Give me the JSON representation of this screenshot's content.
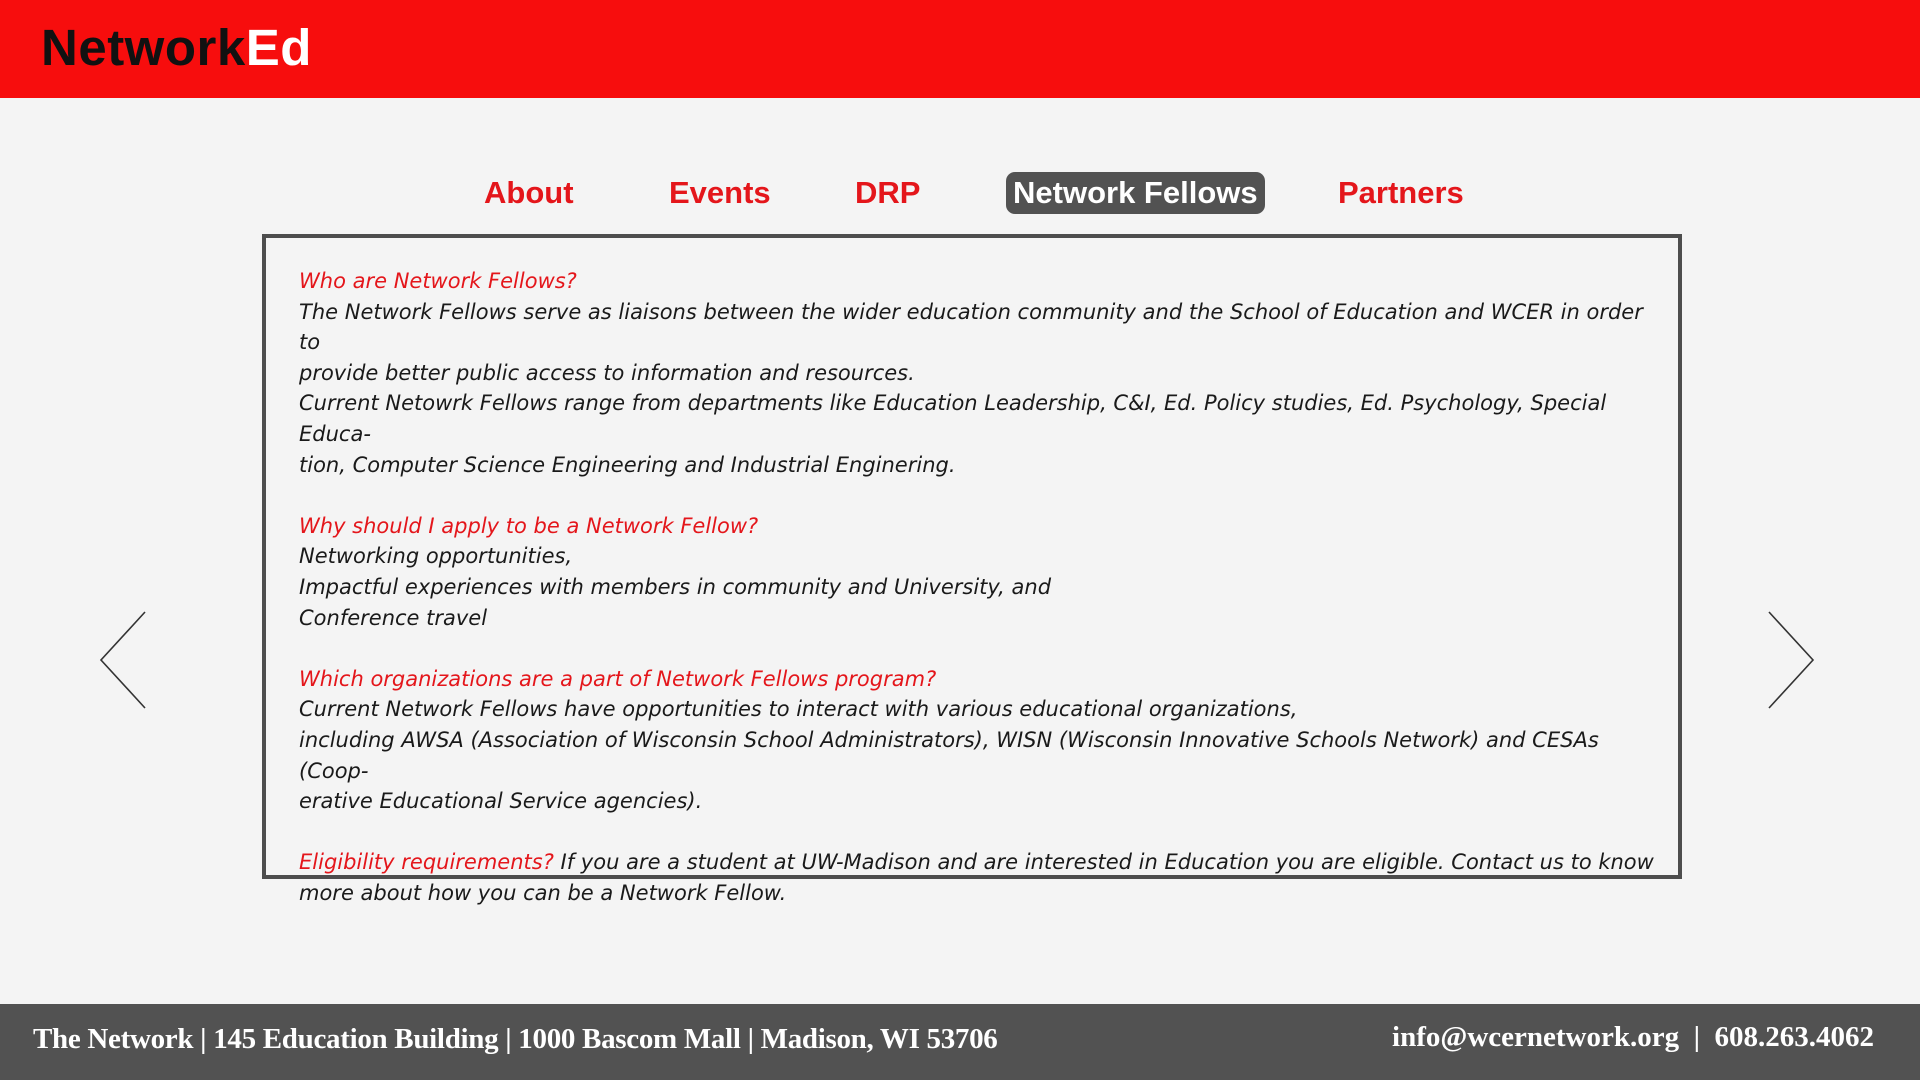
{
  "brand": {
    "part1": "Network",
    "part2": "Ed"
  },
  "nav": {
    "items": [
      {
        "label": "About"
      },
      {
        "label": "Events"
      },
      {
        "label": "DRP"
      },
      {
        "label": "Network Fellows",
        "active": true
      },
      {
        "label": "Partners"
      }
    ]
  },
  "content": {
    "sections": [
      {
        "question": "Who are Network Fellows?",
        "lines": [
          "The Network Fellows serve as liaisons between the wider education community and the School of Education and WCER in order to",
          "provide better public access to information and resources.",
          "Current Netowrk Fellows range from departments like Education Leadership, C&I, Ed. Policy studies, Ed. Psychology, Special Educa-",
          "tion, Computer Science Engineering and Industrial Enginering."
        ]
      },
      {
        "question": "Why should I apply to be a Network Fellow?",
        "lines": [
          "Networking opportunities,",
          "Impactful experiences with members in community and University, and",
          "Conference travel"
        ]
      },
      {
        "question": "Which organizations are a part of Network Fellows program?",
        "lines": [
          "Current Network Fellows have opportunities to interact with various educational organizations,",
          "including AWSA (Association of Wisconsin School Administrators), WISN (Wisconsin Innovative Schools Network) and  CESAs (Coop-",
          "erative Educational Service agencies)."
        ]
      },
      {
        "question": "Eligibility requirements?",
        "inline_text": " If you are a student at UW-Madison and are interested in Education you are eligible. Contact us to know",
        "lines": [
          "more about how you can be a Network Fellow."
        ]
      }
    ]
  },
  "icons": {
    "prev": "chevron-left-icon",
    "next": "chevron-right-icon"
  },
  "footer": {
    "address": "The Network | 145 Education Building | 1000 Bascom Mall | Madison, WI 53706",
    "contact": "info@wcernetwork.org  |  608.263.4062"
  },
  "colors": {
    "header_bg": "#f70d0d",
    "accent_red": "#e4161b",
    "active_tab_bg": "#525252",
    "footer_bg": "#525252",
    "page_bg": "#f4f4f4"
  }
}
